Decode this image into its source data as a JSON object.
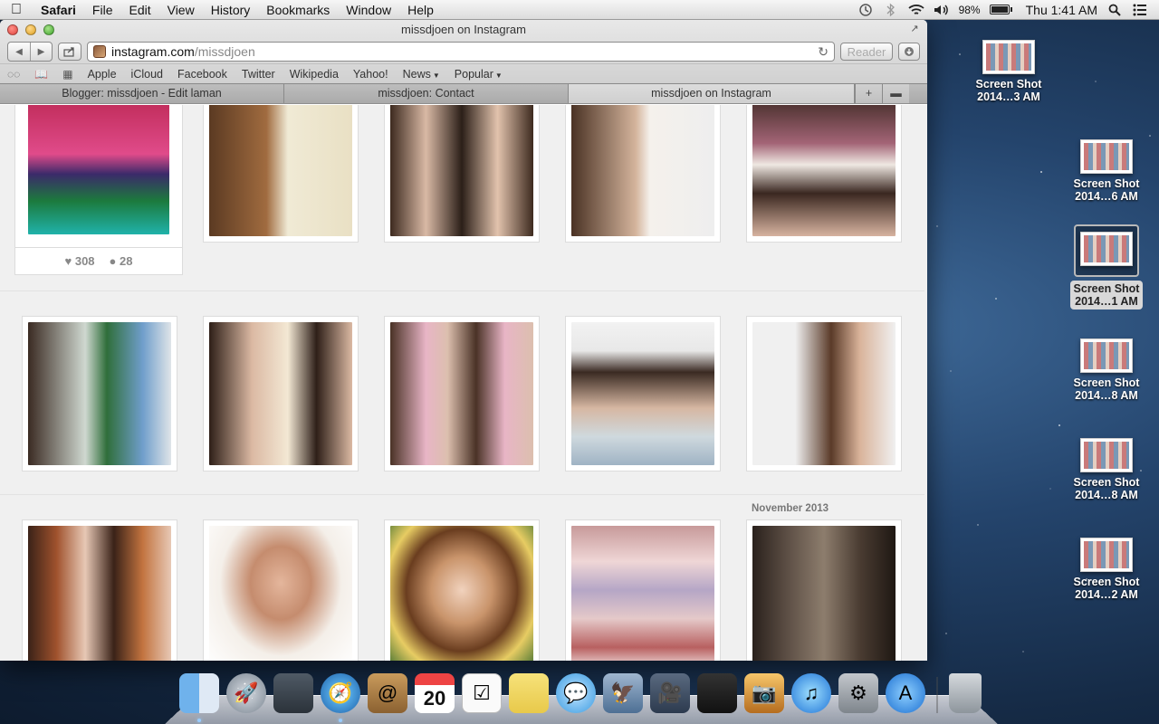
{
  "menubar": {
    "app_name": "Safari",
    "items": [
      "File",
      "Edit",
      "View",
      "History",
      "Bookmarks",
      "Window",
      "Help"
    ],
    "battery_percent": "98%",
    "clock": "Thu 1:41 AM"
  },
  "window": {
    "title": "missdjoen on Instagram",
    "url_host": "instagram.com",
    "url_path": "/missdjoen",
    "reader_label": "Reader",
    "bookmarks": [
      "Apple",
      "iCloud",
      "Facebook",
      "Twitter",
      "Wikipedia",
      "Yahoo!",
      "News",
      "Popular"
    ],
    "tabs": [
      "Blogger: missdjoen - Edit laman",
      "missdjoen: Contact",
      "missdjoen on Instagram"
    ],
    "tab_add_label": "+"
  },
  "feed": {
    "first_post": {
      "likes": "308",
      "comments": "28"
    },
    "month_label": "November 2013"
  },
  "desktop_icons": [
    {
      "line1": "Screen Shot",
      "line2": "2014…3 AM"
    },
    {
      "line1": "Screen Shot",
      "line2": "2014…6 AM"
    },
    {
      "line1": "Screen Shot",
      "line2": "2014…1 AM"
    },
    {
      "line1": "Screen Shot",
      "line2": "2014…8 AM"
    },
    {
      "line1": "Screen Shot",
      "line2": "2014…8 AM"
    },
    {
      "line1": "Screen Shot",
      "line2": "2014…2 AM"
    }
  ],
  "dock": {
    "calendar_day": "20"
  },
  "colors": {
    "desktop_bg": "#1c3556",
    "card_border": "#dcdcdc",
    "feed_bg": "#f0f0f0"
  }
}
